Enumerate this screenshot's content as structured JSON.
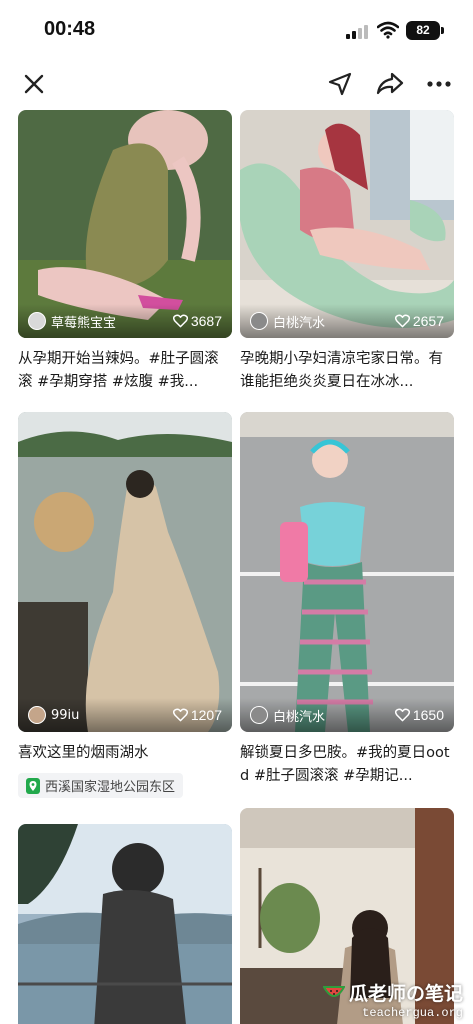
{
  "status_bar": {
    "time": "00:48",
    "battery": "82"
  },
  "nav": {
    "close_icon": "close-icon",
    "share_icon": "send-arrow-icon",
    "forward_icon": "forward-arrow-icon",
    "more_icon": "more-dots-icon"
  },
  "cards": [
    {
      "author": "草莓熊宝宝",
      "likes": "3687",
      "title": "从孕期开始当辣妈。#肚子圆滚滚 #孕期穿搭 #炫腹 #我..."
    },
    {
      "author": "白桃汽水",
      "likes": "2657",
      "title": "孕晚期小孕妇清凉宅家日常。有谁能拒绝炎炎夏日在冰冰..."
    },
    {
      "author": "99iu",
      "likes": "1207",
      "title": "喜欢这里的烟雨湖水",
      "location": "西溪国家湿地公园东区"
    },
    {
      "author": "白桃汽水",
      "likes": "1650",
      "title": "解锁夏日多巴胺。#我的夏日ootd #肚子圆滚滚 #孕期记..."
    }
  ],
  "watermark": {
    "title": "瓜老师の笔记",
    "url": "teachergua.org"
  },
  "colors": {
    "accent_green": "#22a94c",
    "like_white": "#ffffff"
  }
}
